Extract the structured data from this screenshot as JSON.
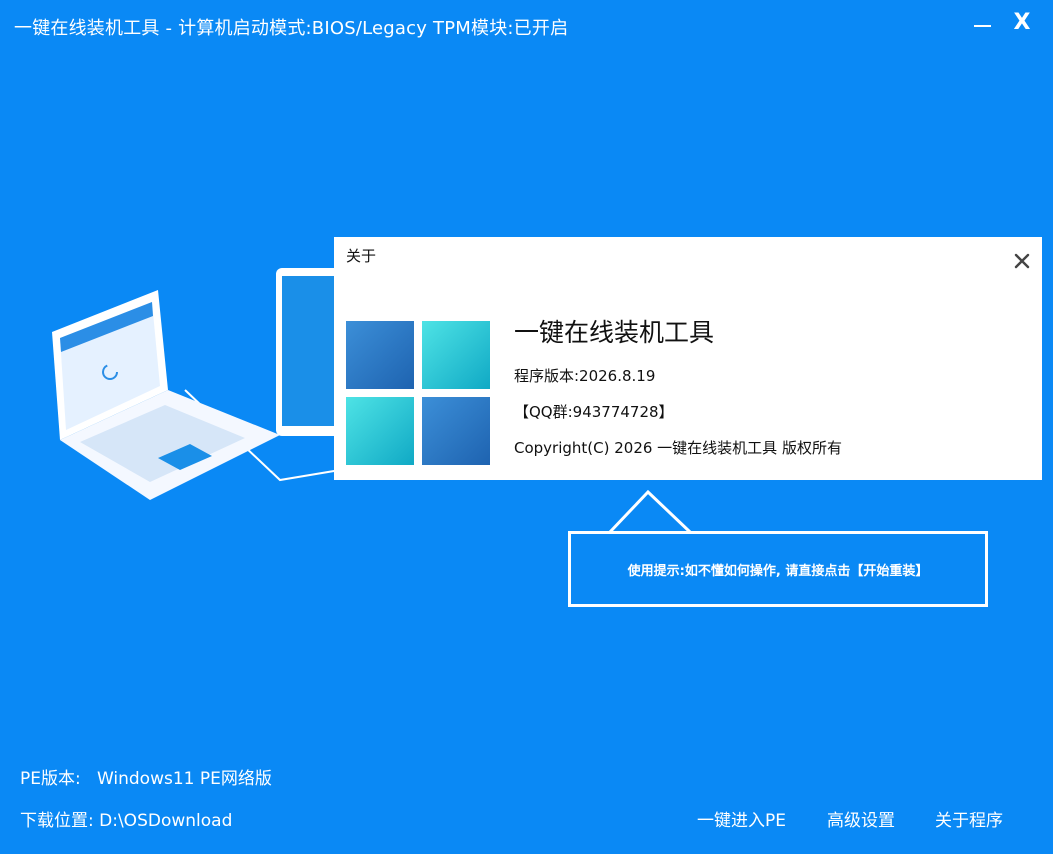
{
  "window": {
    "title": "一键在线装机工具 - 计算机启动模式:BIOS/Legacy TPM模块:已开启",
    "min_icon": "minimize-icon",
    "close_label": "X"
  },
  "dialog": {
    "title": "关于",
    "close_icon": "close-icon",
    "app_name": "一键在线装机工具",
    "version": "程序版本:2026.8.19",
    "qq": "【QQ群:943774728】",
    "copyright": "Copyright(C) 2026 一键在线装机工具 版权所有"
  },
  "tip": {
    "text": "使用提示:如不懂如何操作, 请直接点击【开始重装】"
  },
  "footer": {
    "pe_label": "PE版本:",
    "pe_value": "Windows11 PE网络版",
    "dl_label": "下载位置:",
    "dl_value": "D:\\OSDownload",
    "links": [
      "一键进入PE",
      "高级设置",
      "关于程序"
    ]
  },
  "colors": {
    "background": "#0a89f5",
    "logo_dark": "#1e63b0",
    "logo_light": "#10a9c5"
  }
}
